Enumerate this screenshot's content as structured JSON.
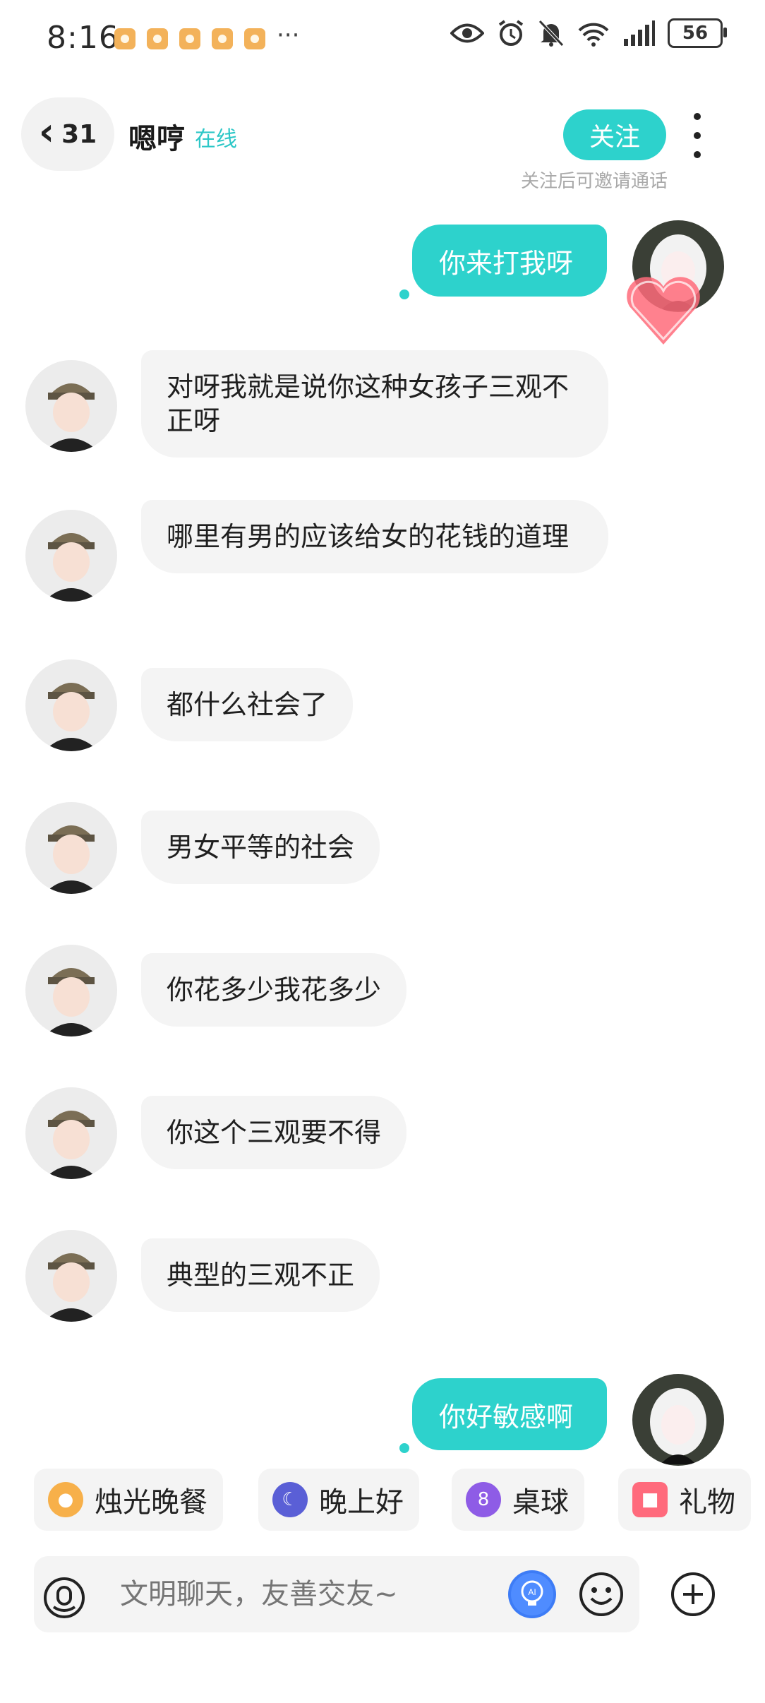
{
  "status_bar": {
    "time": "8:16",
    "overflow": "···",
    "battery": "56"
  },
  "header": {
    "back_count": "31",
    "contact_name": "嗯哼",
    "online_status": "在线",
    "follow_label": "关注",
    "follow_hint": "关注后可邀请通话"
  },
  "messages": [
    {
      "from": "me",
      "text": "你来打我呀"
    },
    {
      "from": "them",
      "text": "对呀我就是说你这种女孩子三观不正呀"
    },
    {
      "from": "them",
      "text": "哪里有男的应该给女的花钱的道理"
    },
    {
      "from": "them",
      "text": "都什么社会了"
    },
    {
      "from": "them",
      "text": "男女平等的社会"
    },
    {
      "from": "them",
      "text": "你花多少我花多少"
    },
    {
      "from": "them",
      "text": "你这个三观要不得"
    },
    {
      "from": "them",
      "text": "典型的三观不正"
    },
    {
      "from": "me",
      "text": "你好敏感啊"
    }
  ],
  "quick_actions": [
    {
      "label": "烛光晚餐",
      "icon": "candlelight-dinner-icon"
    },
    {
      "label": "晚上好",
      "icon": "moon-icon"
    },
    {
      "label": "桌球",
      "icon": "billiard-ball-icon"
    },
    {
      "label": "礼物",
      "icon": "gift-icon"
    }
  ],
  "input": {
    "placeholder": "文明聊天，友善交友~"
  },
  "colors": {
    "accent": "#2dd2cc",
    "bubble_in": "#f4f4f4",
    "online": "#2dc7c7"
  }
}
